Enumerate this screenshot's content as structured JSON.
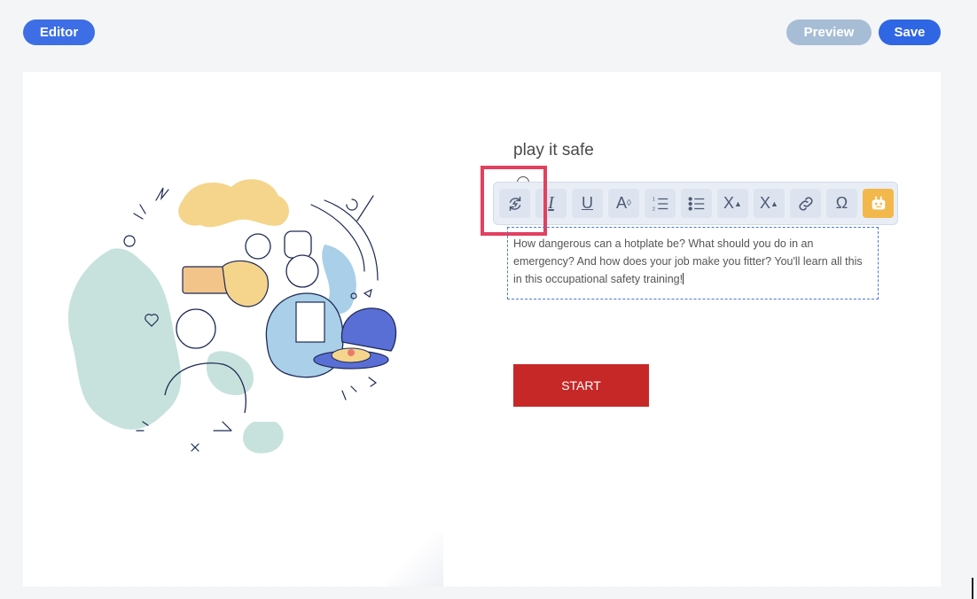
{
  "header": {
    "editor_label": "Editor",
    "preview_label": "Preview",
    "save_label": "Save"
  },
  "slide": {
    "title": "play it safe",
    "body_text": "How dangerous can a hotplate be? What should you do in an emergency? And how does your job make you fitter? You'll learn all this in this occupational safety training!",
    "start_label": "START"
  },
  "toolbar": {
    "italic": "I",
    "underline": "U",
    "font_size": "A",
    "superscript": "X",
    "subscript": "X",
    "special_char": "Ω"
  },
  "icons": [
    "refresh-icon",
    "italic-icon",
    "underline-icon",
    "font-size-icon",
    "ordered-list-icon",
    "unordered-list-icon",
    "superscript-icon",
    "subscript-icon",
    "link-icon",
    "omega-icon",
    "robot-icon"
  ],
  "colors": {
    "primary": "#3d6ee6",
    "preview_disabled": "#a7bdd6",
    "start_button": "#c62828",
    "highlight": "#e2405f",
    "toolbar_active": "#f2b84b"
  }
}
